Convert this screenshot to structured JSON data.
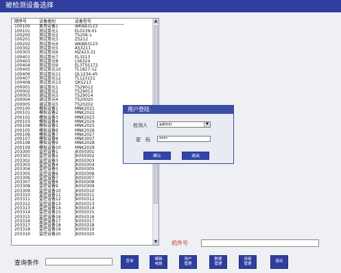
{
  "window": {
    "title": "被检测设备选择"
  },
  "device_list": {
    "headers": [
      "顺序号",
      "设备类别",
      "设备型号"
    ],
    "rows": [
      [
        "100100",
        "复用设备1",
        "WKBB3123"
      ],
      [
        "100101",
        "测试单元1",
        "EL0239-01"
      ],
      [
        "100200",
        "测试单元2",
        "TS206-1"
      ],
      [
        "100201",
        "测试单元3",
        "ZS212"
      ],
      [
        "100202",
        "测试单元4",
        "WKBB3123"
      ],
      [
        "100302",
        "测试单元5",
        "AS3211"
      ],
      [
        "100303",
        "测试单元6",
        "MZ423-31"
      ],
      [
        "100401",
        "测试单元7",
        "EL3213"
      ],
      [
        "100403",
        "测试单元8",
        "LS6324"
      ],
      [
        "100404",
        "测试单元9",
        "EL3TSS172"
      ],
      [
        "100405",
        "测试单元10",
        "TL1827-12"
      ],
      [
        "100406",
        "测试单元11",
        "QL1234-45"
      ],
      [
        "100407",
        "测试单元12",
        "TL123151"
      ],
      [
        "100408",
        "测试单元13",
        "QKS213"
      ],
      [
        "200001",
        "调试单元1",
        "TS29012"
      ],
      [
        "200002",
        "调试单元2",
        "TS29013"
      ],
      [
        "200003",
        "调试单元3",
        "TS29014"
      ],
      [
        "200004",
        "调试单元4",
        "TS20020"
      ],
      [
        "200005",
        "调试单元5",
        "TS20202"
      ],
      [
        "200100",
        "模拟设备1",
        "MNK2021"
      ],
      [
        "200101",
        "模拟设备2",
        "MNK2022"
      ],
      [
        "200102",
        "模拟设备3",
        "MNK2023"
      ],
      [
        "200103",
        "模拟设备4",
        "MNK2024"
      ],
      [
        "200104",
        "模拟设备5",
        "MNK2025"
      ],
      [
        "200105",
        "模拟设备6",
        "MNK2026"
      ],
      [
        "200106",
        "模拟设备7",
        "MNK2027"
      ],
      [
        "200107",
        "模拟设备8",
        "MNK3007"
      ],
      [
        "200108",
        "模拟设备9",
        "MNK2028"
      ],
      [
        "200109",
        "模拟设备10",
        "MNK2029"
      ],
      [
        "203300",
        "监控设备1",
        "JK050301"
      ],
      [
        "203301",
        "监控设备2",
        "JK050302"
      ],
      [
        "203302",
        "监控设备3",
        "JK050303"
      ],
      [
        "203303",
        "监控设备4",
        "JK050304"
      ],
      [
        "203304",
        "监控设备5",
        "JK050305"
      ],
      [
        "203305",
        "监控设备6",
        "JK050306"
      ],
      [
        "203306",
        "监控设备7",
        "JK050307"
      ],
      [
        "203307",
        "监控设备8",
        "JK050308"
      ],
      [
        "203308",
        "监控设备9",
        "JK050309"
      ],
      [
        "203309",
        "监控设备10",
        "JK050310"
      ],
      [
        "203310",
        "监控设备11",
        "JK050311"
      ],
      [
        "203311",
        "监控设备12",
        "JK050312"
      ],
      [
        "203312",
        "监控设备13",
        "JK050313"
      ],
      [
        "203313",
        "监控设备14",
        "JK050314"
      ],
      [
        "203314",
        "监控设备15",
        "JK050315"
      ],
      [
        "203315",
        "监控设备16",
        "JK050316"
      ],
      [
        "203316",
        "监控设备17",
        "JK050317"
      ],
      [
        "203317",
        "监控设备18",
        "JK050318"
      ],
      [
        "203318",
        "监控设备19",
        "JK050319"
      ],
      [
        "203319",
        "监控设备20",
        "JK050320"
      ]
    ]
  },
  "login": {
    "title": "用户登陆",
    "user_label": "检测人",
    "user_value": "admin",
    "password_label": "密　码",
    "password_value": "****",
    "confirm_label": "确认",
    "exit_label": "退出"
  },
  "machine": {
    "label": "机件号",
    "value": ""
  },
  "query": {
    "label": "查询条件",
    "value": ""
  },
  "buttons": {
    "query": "查询",
    "debug_circuit": "编辑\n电路",
    "user_manage": "用户\n管理",
    "data_manage": "数据\n管理",
    "connect_manage": "连接\n管理",
    "exit": "退出"
  },
  "colors": {
    "title_bar": "#2f3e9e",
    "button": "#2f3e9e",
    "machine_label": "#c0392b"
  }
}
